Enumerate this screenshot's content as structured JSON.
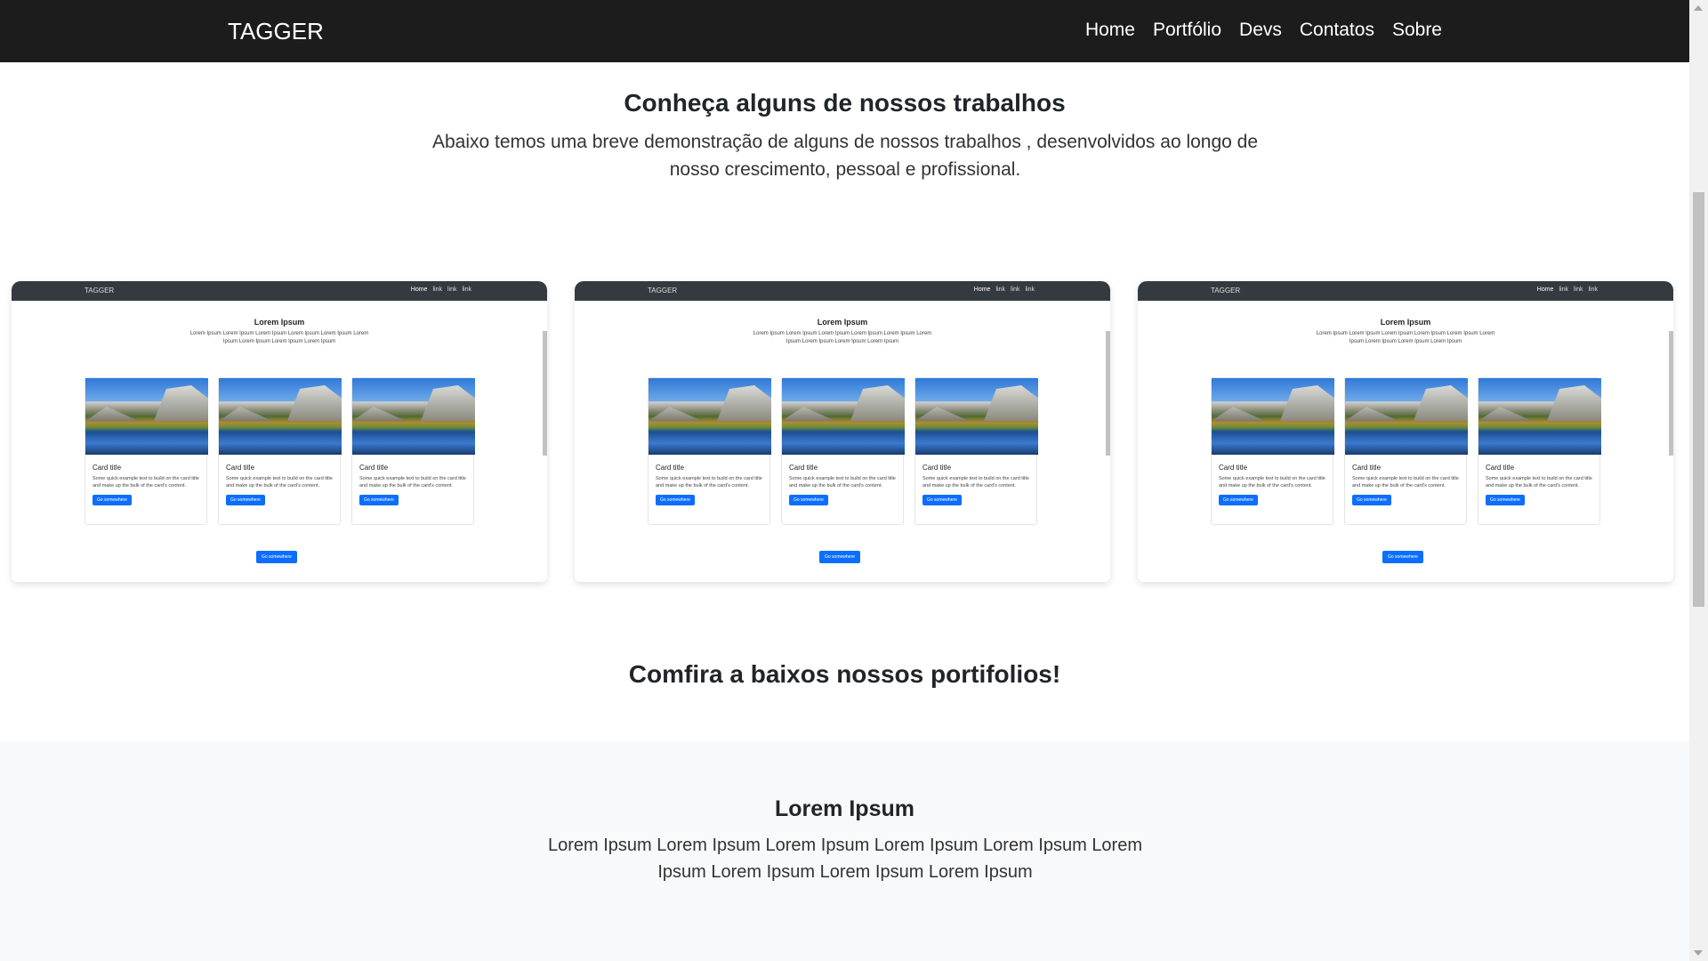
{
  "navbar": {
    "brand": "TAGGER",
    "links": [
      "Home",
      "Portfólio",
      "Devs",
      "Contatos",
      "Sobre"
    ]
  },
  "works": {
    "title": "Conheça alguns de nossos trabalhos",
    "description": "Abaixo temos uma breve demonstração de alguns de nossos trabalhos , desenvolvidos ao longo de nosso crescimento, pessoal e profissional."
  },
  "screenshot_preview": {
    "brand": "TAGGER",
    "links": [
      "Home",
      "link",
      "link",
      "link"
    ],
    "title": "Lorem Ipsum",
    "subtitle": "Lorem Ipsum Lorem Ipsum Lorem Ipsum Lorem Ipsum Lorem Ipsum Lorem Ipsum Lorem Ipsum Lorem Ipsum Lorem Ipsum",
    "card_title": "Card title",
    "card_text": "Some quick example text to build on the card title and make up the bulk of the card's content.",
    "card_button": "Go somewhere",
    "bottom_button": "Go somewhere"
  },
  "portfolio": {
    "title": "Comfira a baixos nossos portifolios!"
  },
  "lorem_section": {
    "title": "Lorem Ipsum",
    "text": "Lorem Ipsum Lorem Ipsum Lorem Ipsum Lorem Ipsum Lorem Ipsum Lorem Ipsum Lorem Ipsum Lorem Ipsum Lorem Ipsum"
  },
  "colors": {
    "navbar_bg": "#1c1c1c",
    "primary_button": "#0d6efd",
    "light_section_bg": "#f8f9fa"
  }
}
